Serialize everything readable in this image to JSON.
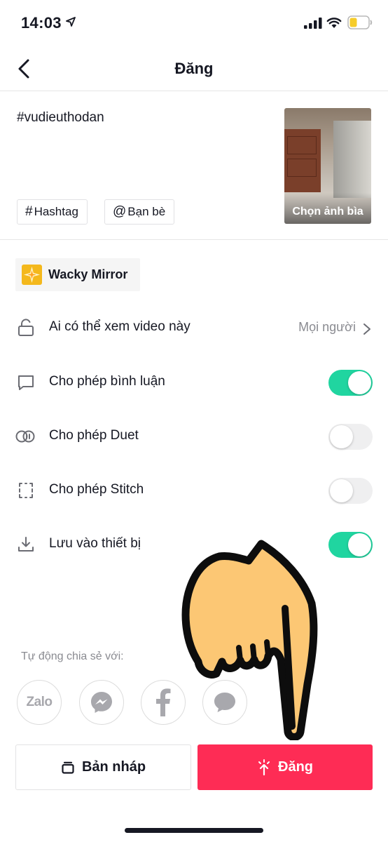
{
  "status_bar": {
    "time": "14:03"
  },
  "nav": {
    "title": "Đăng"
  },
  "caption": {
    "text": "#vudieuthodan"
  },
  "tags": {
    "hashtag_label": "Hashtag",
    "friends_label": "Bạn bè"
  },
  "cover": {
    "label": "Chọn ảnh bìa"
  },
  "effect": {
    "label": "Wacky Mirror"
  },
  "settings": {
    "privacy": {
      "label": "Ai có thể xem video này",
      "value": "Mọi người"
    },
    "comments": {
      "label": "Cho phép bình luận",
      "enabled": true
    },
    "duet": {
      "label": "Cho phép Duet",
      "enabled": false
    },
    "stitch": {
      "label": "Cho phép Stitch",
      "enabled": false
    },
    "save": {
      "label": "Lưu vào thiết bị",
      "enabled": true
    }
  },
  "share": {
    "label": "Tự động chia sẻ với:",
    "targets": [
      "Zalo",
      "messenger-icon",
      "facebook-icon",
      "message-icon"
    ]
  },
  "actions": {
    "draft_label": "Bản nháp",
    "post_label": "Đăng"
  },
  "colors": {
    "post_button": "#fe2c55",
    "toggle_on": "#20d5a0",
    "effect_badge": "#f4b81c"
  }
}
